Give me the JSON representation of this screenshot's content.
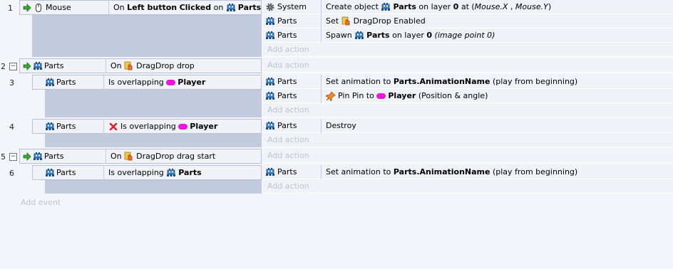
{
  "common": {
    "add_action": "Add action",
    "add_event": "Add event"
  },
  "events": [
    {
      "number": "1",
      "conditions": [
        {
          "object": "Mouse",
          "parts": [
            {
              "t": "On "
            },
            {
              "t": "Left button",
              "b": true
            },
            {
              "t": " "
            },
            {
              "t": "Clicked",
              "b": true
            },
            {
              "t": " on "
            },
            {
              "icon": "parts-icon"
            },
            {
              "t": "Parts",
              "b": true
            }
          ]
        }
      ],
      "actions": [
        {
          "object": "System",
          "parts": [
            {
              "t": "Create object "
            },
            {
              "icon": "parts-icon"
            },
            {
              "t": "Parts",
              "b": true
            },
            {
              "t": " on layer "
            },
            {
              "t": "0",
              "b": true
            },
            {
              "t": " at ("
            },
            {
              "t": "Mouse.X",
              "i": true
            },
            {
              "t": " , "
            },
            {
              "t": "Mouse.Y",
              "i": true
            },
            {
              "t": ")"
            }
          ]
        },
        {
          "object": "Parts",
          "parts": [
            {
              "t": "Set "
            },
            {
              "icon": "dragdrop-icon"
            },
            {
              "t": "DragDrop Enabled"
            }
          ]
        },
        {
          "object": "Parts",
          "parts": [
            {
              "t": "Spawn "
            },
            {
              "icon": "parts-icon"
            },
            {
              "t": "Parts",
              "b": true
            },
            {
              "t": " on layer "
            },
            {
              "t": "0",
              "b": true
            },
            {
              "t": " "
            },
            {
              "t": "(image point 0)",
              "i": true
            }
          ]
        }
      ]
    },
    {
      "number": "2",
      "conditions": [
        {
          "object": "Parts",
          "parts": [
            {
              "t": "On "
            },
            {
              "icon": "dragdrop-icon"
            },
            {
              "t": "DragDrop drop"
            }
          ]
        }
      ],
      "actions": []
    },
    {
      "number": "3",
      "conditions": [
        {
          "object": "Parts",
          "parts": [
            {
              "t": "Is overlapping "
            },
            {
              "icon": "player-pill"
            },
            {
              "t": "Player",
              "b": true
            }
          ]
        }
      ],
      "actions": [
        {
          "object": "Parts",
          "parts": [
            {
              "t": "Set animation to "
            },
            {
              "t": "Parts.AnimationName",
              "b": true
            },
            {
              "t": " (play from beginning)"
            }
          ]
        },
        {
          "object": "Parts",
          "parts": [
            {
              "icon": "pin-icon"
            },
            {
              "t": "Pin Pin to "
            },
            {
              "icon": "player-pill"
            },
            {
              "t": "Player",
              "b": true
            },
            {
              "t": " (Position & angle)"
            }
          ]
        }
      ]
    },
    {
      "number": "4",
      "conditions": [
        {
          "object": "Parts",
          "parts": [
            {
              "icon": "invert-x-icon"
            },
            {
              "t": "Is overlapping "
            },
            {
              "icon": "player-pill"
            },
            {
              "t": "Player",
              "b": true
            }
          ]
        }
      ],
      "actions": [
        {
          "object": "Parts",
          "parts": [
            {
              "t": "Destroy"
            }
          ]
        }
      ]
    },
    {
      "number": "5",
      "conditions": [
        {
          "object": "Parts",
          "parts": [
            {
              "t": "On "
            },
            {
              "icon": "dragdrop-icon"
            },
            {
              "t": "DragDrop drag start"
            }
          ]
        }
      ],
      "actions": []
    },
    {
      "number": "6",
      "conditions": [
        {
          "object": "Parts",
          "parts": [
            {
              "t": "Is overlapping "
            },
            {
              "icon": "parts-icon"
            },
            {
              "t": "Parts",
              "b": true
            }
          ]
        }
      ],
      "actions": [
        {
          "object": "Parts",
          "parts": [
            {
              "t": "Set animation to "
            },
            {
              "t": "Parts.AnimationName",
              "b": true
            },
            {
              "t": " (play from beginning)"
            }
          ]
        }
      ]
    }
  ],
  "colors": {
    "background": "#f4f5fa",
    "row": "#f0f2f7",
    "empty_block": "#c2cbdd",
    "player": "#ec17d9",
    "add_text": "#bcc3d1"
  }
}
